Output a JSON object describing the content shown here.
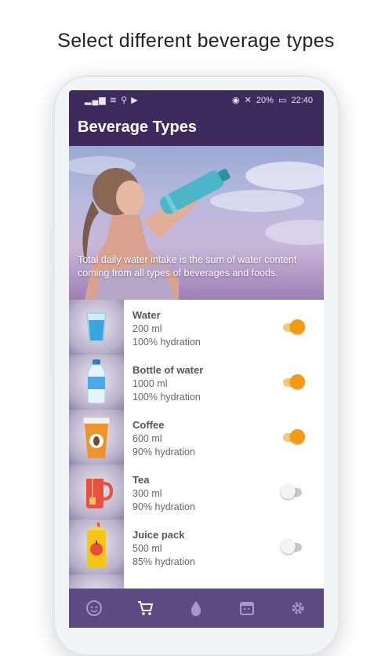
{
  "caption": "Select different beverage types",
  "status_bar": {
    "left_icons": [
      "signal-icon",
      "wifi-icon",
      "usb-icon",
      "play-store-icon"
    ],
    "battery_percent": "20%",
    "time": "22:40"
  },
  "app_bar": {
    "title": "Beverage Types"
  },
  "hero": {
    "text": "Total daily water intake is the sum of water content coming from all types of beverages and foods."
  },
  "beverages": [
    {
      "name": "Water",
      "volume": "200 ml",
      "hydration": "100% hydration",
      "enabled": true,
      "icon": "water-glass-icon"
    },
    {
      "name": "Bottle of water",
      "volume": "1000 ml",
      "hydration": "100% hydration",
      "enabled": true,
      "icon": "water-bottle-icon"
    },
    {
      "name": "Coffee",
      "volume": "600 ml",
      "hydration": "90% hydration",
      "enabled": true,
      "icon": "coffee-cup-icon"
    },
    {
      "name": "Tea",
      "volume": "300 ml",
      "hydration": "90% hydration",
      "enabled": false,
      "icon": "tea-mug-icon"
    },
    {
      "name": "Juice pack",
      "volume": "500 ml",
      "hydration": "85% hydration",
      "enabled": false,
      "icon": "juice-pack-icon"
    }
  ],
  "bottom_nav": {
    "items": [
      "face-icon",
      "cart-icon",
      "drop-icon",
      "calendar-icon",
      "gear-icon"
    ],
    "active": "cart-icon"
  },
  "colors": {
    "primary": "#3e2a5c",
    "nav": "#5e4a82",
    "accent": "#f39c12"
  }
}
